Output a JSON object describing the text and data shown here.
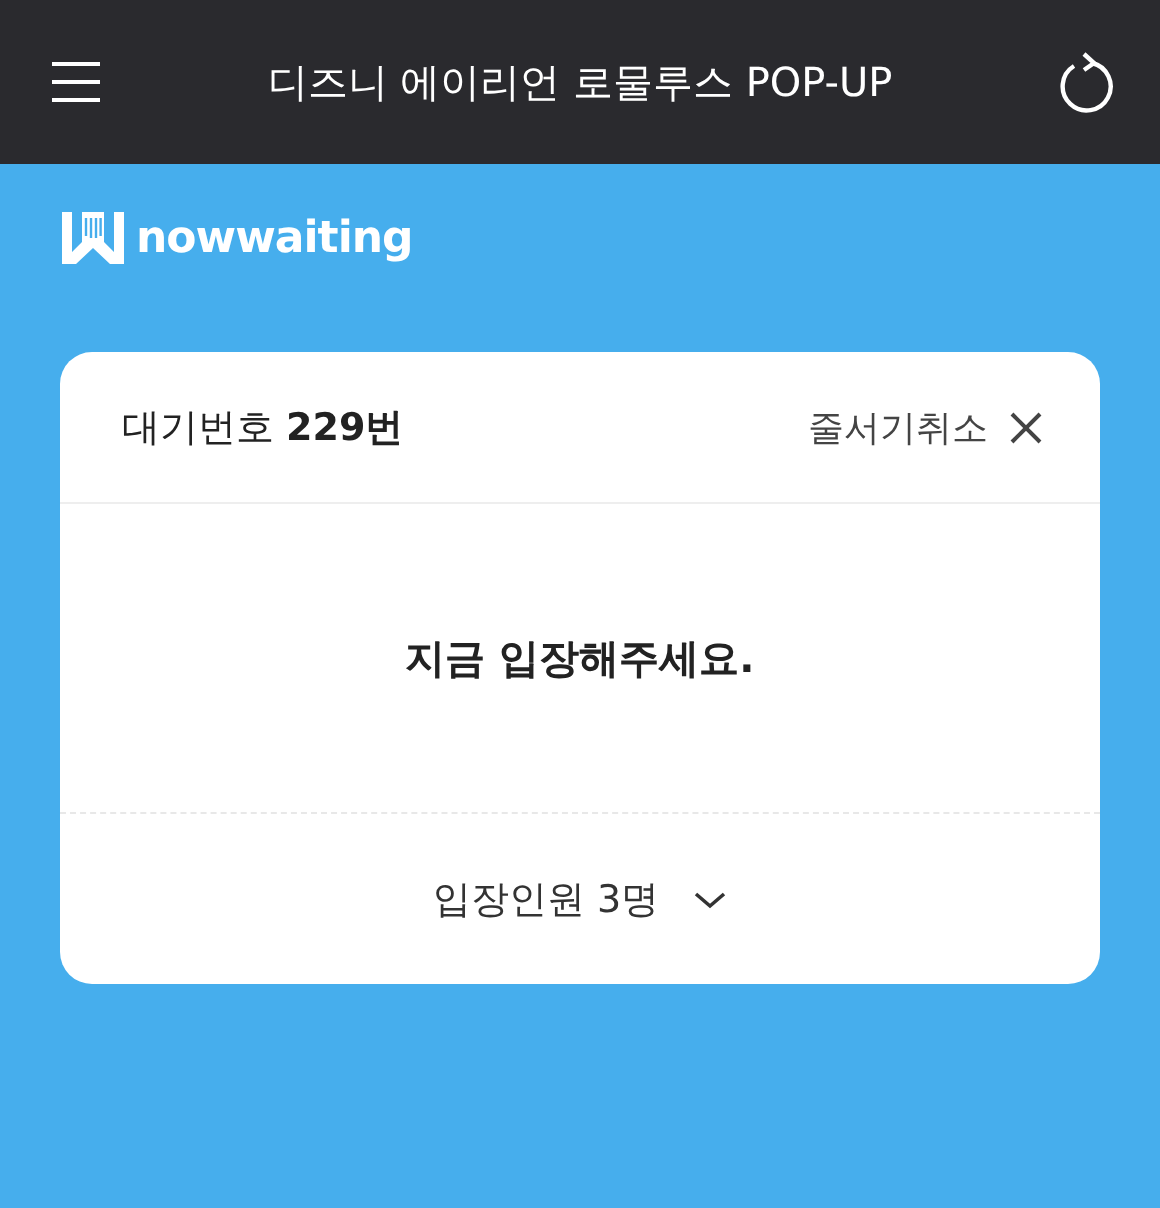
{
  "top_bar": {
    "title": "디즈니 에이리언 로물루스 POP-UP"
  },
  "brand": {
    "name": "nowwaiting"
  },
  "ticket": {
    "queue_number": "대기번호 **229번**",
    "cancel_label": "줄서기취소",
    "message": "지금 입장해주세요.",
    "party_size": "입장인원 3명",
    "expanded": false
  }
}
